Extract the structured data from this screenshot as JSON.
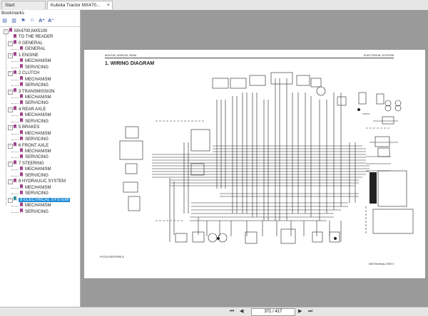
{
  "tabs": [
    {
      "label": "Start"
    },
    {
      "label": "Kubota Tractor MX470..."
    }
  ],
  "sidebar": {
    "title": "Bookmarks",
    "tree": [
      {
        "label": "MX4700,MX5100",
        "level": 0
      },
      {
        "label": "TO THE READER",
        "level": 1
      },
      {
        "label": "0 GENERAL",
        "level": 1
      },
      {
        "label": "GENERAL",
        "level": 2
      },
      {
        "label": "1 ENGINE",
        "level": 1
      },
      {
        "label": "MECHANISM",
        "level": 2
      },
      {
        "label": "SERVICING",
        "level": 2
      },
      {
        "label": "2 CLUTCH",
        "level": 1
      },
      {
        "label": "MECHANISM",
        "level": 2
      },
      {
        "label": "SERVICING",
        "level": 2
      },
      {
        "label": "3 TRANSMISSION",
        "level": 1
      },
      {
        "label": "MECHANISM",
        "level": 2
      },
      {
        "label": "SERVICING",
        "level": 2
      },
      {
        "label": "4 REAR AXLE",
        "level": 1
      },
      {
        "label": "MECHANISM",
        "level": 2
      },
      {
        "label": "SERVICING",
        "level": 2
      },
      {
        "label": "5 BRAKES",
        "level": 1
      },
      {
        "label": "MECHANISM",
        "level": 2
      },
      {
        "label": "SERVICING",
        "level": 2
      },
      {
        "label": "6 FRONT AXLE",
        "level": 1
      },
      {
        "label": "MECHANISM",
        "level": 2
      },
      {
        "label": "SERVICING",
        "level": 2
      },
      {
        "label": "7 STEERING",
        "level": 1
      },
      {
        "label": "MECHANISM",
        "level": 2
      },
      {
        "label": "SERVICING",
        "level": 2
      },
      {
        "label": "8 HYDRAULIC SYSTEM",
        "level": 1
      },
      {
        "label": "MECHANISM",
        "level": 2
      },
      {
        "label": "SERVICING",
        "level": 2
      },
      {
        "label": "9 ELECTRICAL SYSTEM",
        "level": 1,
        "selected": true
      },
      {
        "label": "MECHANISM",
        "level": 2
      },
      {
        "label": "SERVICING",
        "level": 2
      }
    ]
  },
  "document": {
    "model_header": "MX4700, MX5100, WSM",
    "section_header": "ELECTRICAL SYSTEM",
    "title": "1. WIRING DIAGRAM",
    "figure_code": "9Y1124-S0DF009E-A",
    "footer": "MX5 Electrical, 2009 3"
  },
  "pagination": {
    "current": "371 / 417"
  },
  "colors": {
    "selection": "#1f8dd6",
    "bookmark_icon": "#a0428b",
    "viewer_bg": "#9a9a9a"
  }
}
